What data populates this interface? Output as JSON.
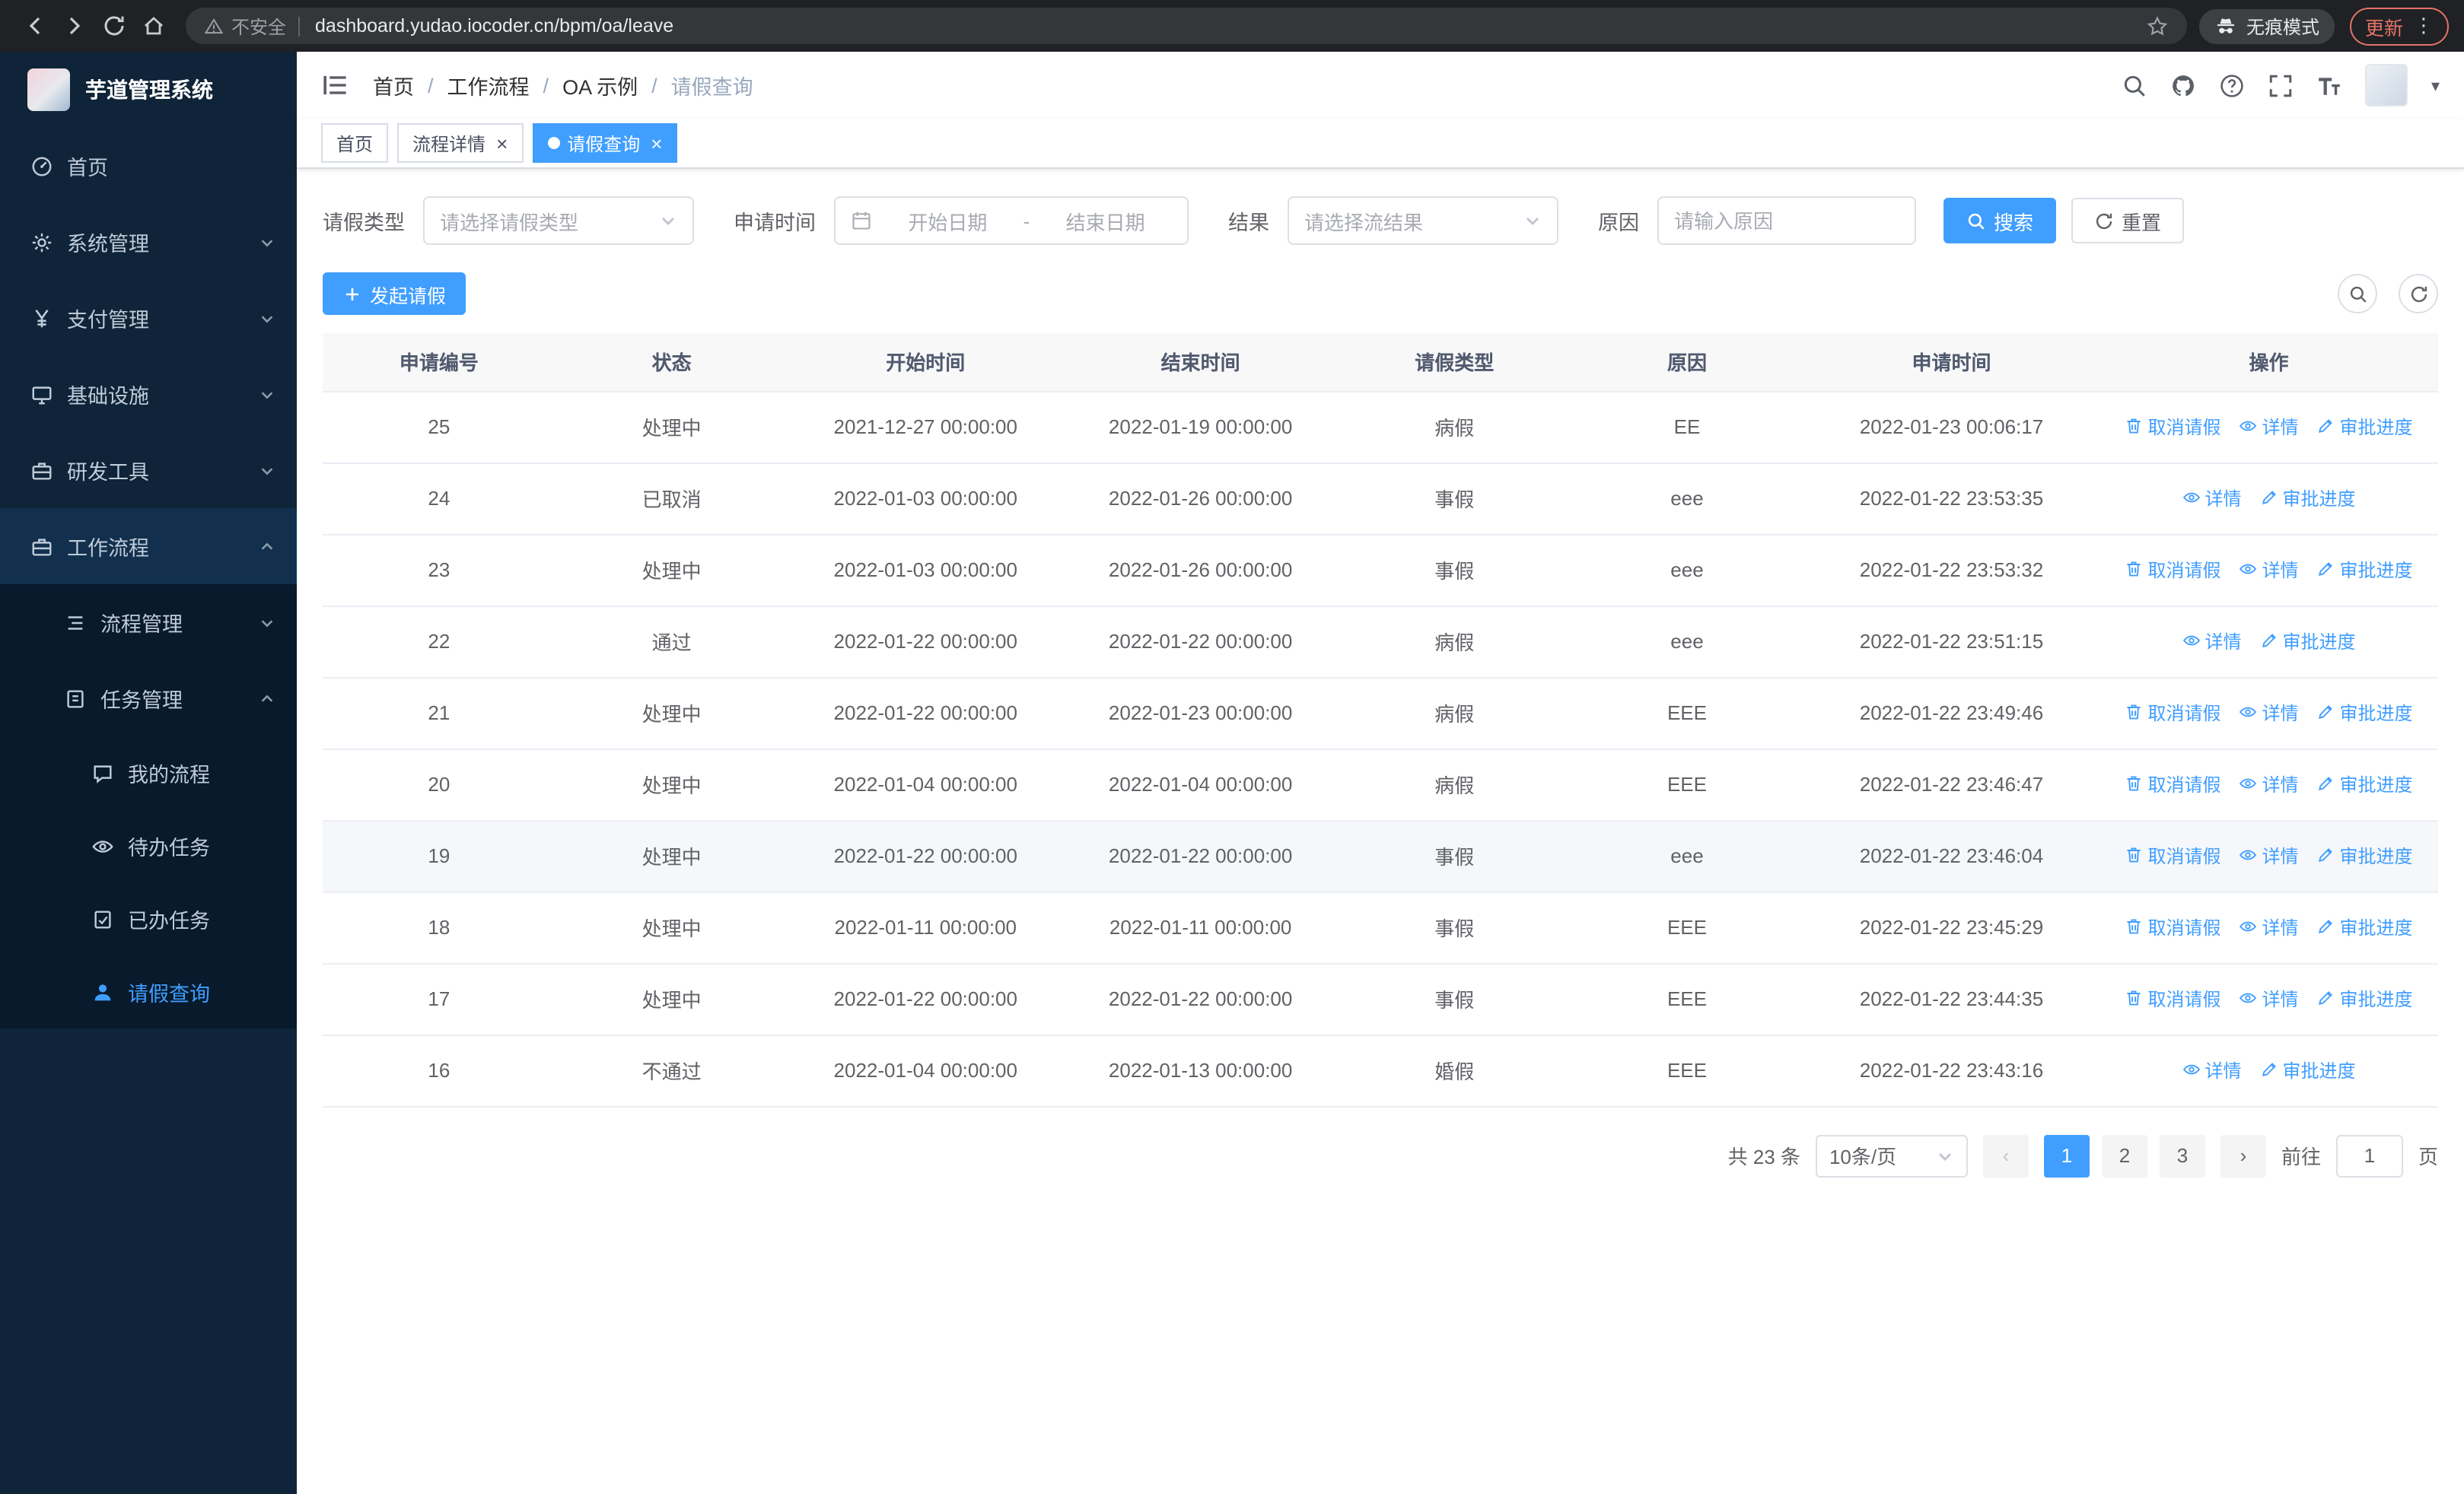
{
  "browser": {
    "security_label": "不安全",
    "url": "dashboard.yudao.iocoder.cn/bpm/oa/leave",
    "incognito_label": "无痕模式",
    "update_label": "更新"
  },
  "sidebar": {
    "logo_title": "芋道管理系统",
    "items": [
      {
        "key": "home",
        "label": "首页",
        "icon": "dashboard",
        "level": 1
      },
      {
        "key": "system",
        "label": "系统管理",
        "icon": "gear",
        "level": 1,
        "chevron": "down"
      },
      {
        "key": "payment",
        "label": "支付管理",
        "icon": "yen",
        "level": 1,
        "chevron": "down"
      },
      {
        "key": "infra",
        "label": "基础设施",
        "icon": "infra",
        "level": 1,
        "chevron": "down"
      },
      {
        "key": "devtools",
        "label": "研发工具",
        "icon": "briefcase",
        "level": 1,
        "chevron": "down"
      },
      {
        "key": "workflow",
        "label": "工作流程",
        "icon": "briefcase",
        "level": 1,
        "chevron": "up",
        "open": true
      },
      {
        "key": "process-mgmt",
        "label": "流程管理",
        "icon": "process",
        "level": 2,
        "chevron": "down"
      },
      {
        "key": "task-mgmt",
        "label": "任务管理",
        "icon": "task",
        "level": 2,
        "chevron": "up"
      },
      {
        "key": "my-process",
        "label": "我的流程",
        "icon": "chat",
        "level": 3
      },
      {
        "key": "todo-tasks",
        "label": "待办任务",
        "icon": "eye",
        "level": 3
      },
      {
        "key": "done-tasks",
        "label": "已办任务",
        "icon": "done",
        "level": 3
      },
      {
        "key": "leave-query",
        "label": "请假查询",
        "icon": "user",
        "level": 3,
        "active": true
      }
    ]
  },
  "header": {
    "breadcrumb": [
      {
        "label": "首页"
      },
      {
        "label": "工作流程"
      },
      {
        "label": "OA 示例"
      },
      {
        "label": "请假查询",
        "current": true
      }
    ]
  },
  "tabs": [
    {
      "key": "home",
      "label": "首页",
      "closable": false,
      "active": false
    },
    {
      "key": "process-detail",
      "label": "流程详情",
      "closable": true,
      "active": false
    },
    {
      "key": "leave-query",
      "label": "请假查询",
      "closable": true,
      "active": true
    }
  ],
  "filters": {
    "leave_type": {
      "label": "请假类型",
      "placeholder": "请选择请假类型"
    },
    "apply_time": {
      "label": "申请时间",
      "start_placeholder": "开始日期",
      "separator": "-",
      "end_placeholder": "结束日期"
    },
    "result": {
      "label": "结果",
      "placeholder": "请选择流结果"
    },
    "reason": {
      "label": "原因",
      "placeholder": "请输入原因"
    },
    "search_label": "搜索",
    "reset_label": "重置"
  },
  "toolbar": {
    "create_label": "发起请假"
  },
  "table": {
    "columns": [
      "申请编号",
      "状态",
      "开始时间",
      "结束时间",
      "请假类型",
      "原因",
      "申请时间",
      "操作"
    ],
    "action_labels": {
      "cancel": "取消请假",
      "detail": "详情",
      "progress": "审批进度"
    },
    "rows": [
      {
        "id": "25",
        "status": "处理中",
        "start": "2021-12-27 00:00:00",
        "end": "2022-01-19 00:00:00",
        "type": "病假",
        "reason": "EE",
        "applied": "2022-01-23 00:06:17",
        "actions": [
          "cancel",
          "detail",
          "progress"
        ]
      },
      {
        "id": "24",
        "status": "已取消",
        "start": "2022-01-03 00:00:00",
        "end": "2022-01-26 00:00:00",
        "type": "事假",
        "reason": "eee",
        "applied": "2022-01-22 23:53:35",
        "actions": [
          "detail",
          "progress"
        ]
      },
      {
        "id": "23",
        "status": "处理中",
        "start": "2022-01-03 00:00:00",
        "end": "2022-01-26 00:00:00",
        "type": "事假",
        "reason": "eee",
        "applied": "2022-01-22 23:53:32",
        "actions": [
          "cancel",
          "detail",
          "progress"
        ]
      },
      {
        "id": "22",
        "status": "通过",
        "start": "2022-01-22 00:00:00",
        "end": "2022-01-22 00:00:00",
        "type": "病假",
        "reason": "eee",
        "applied": "2022-01-22 23:51:15",
        "actions": [
          "detail",
          "progress"
        ]
      },
      {
        "id": "21",
        "status": "处理中",
        "start": "2022-01-22 00:00:00",
        "end": "2022-01-23 00:00:00",
        "type": "病假",
        "reason": "EEE",
        "applied": "2022-01-22 23:49:46",
        "actions": [
          "cancel",
          "detail",
          "progress"
        ]
      },
      {
        "id": "20",
        "status": "处理中",
        "start": "2022-01-04 00:00:00",
        "end": "2022-01-04 00:00:00",
        "type": "病假",
        "reason": "EEE",
        "applied": "2022-01-22 23:46:47",
        "actions": [
          "cancel",
          "detail",
          "progress"
        ]
      },
      {
        "id": "19",
        "status": "处理中",
        "start": "2022-01-22 00:00:00",
        "end": "2022-01-22 00:00:00",
        "type": "事假",
        "reason": "eee",
        "applied": "2022-01-22 23:46:04",
        "actions": [
          "cancel",
          "detail",
          "progress"
        ],
        "highlighted": true
      },
      {
        "id": "18",
        "status": "处理中",
        "start": "2022-01-11 00:00:00",
        "end": "2022-01-11 00:00:00",
        "type": "事假",
        "reason": "EEE",
        "applied": "2022-01-22 23:45:29",
        "actions": [
          "cancel",
          "detail",
          "progress"
        ]
      },
      {
        "id": "17",
        "status": "处理中",
        "start": "2022-01-22 00:00:00",
        "end": "2022-01-22 00:00:00",
        "type": "事假",
        "reason": "EEE",
        "applied": "2022-01-22 23:44:35",
        "actions": [
          "cancel",
          "detail",
          "progress"
        ]
      },
      {
        "id": "16",
        "status": "不通过",
        "start": "2022-01-04 00:00:00",
        "end": "2022-01-13 00:00:00",
        "type": "婚假",
        "reason": "EEE",
        "applied": "2022-01-22 23:43:16",
        "actions": [
          "detail",
          "progress"
        ]
      }
    ]
  },
  "pagination": {
    "total_text": "共 23 条",
    "page_size": "10条/页",
    "pages": [
      "1",
      "2",
      "3"
    ],
    "active_page": "1",
    "goto_label": "前往",
    "goto_value": "1",
    "page_label": "页"
  }
}
